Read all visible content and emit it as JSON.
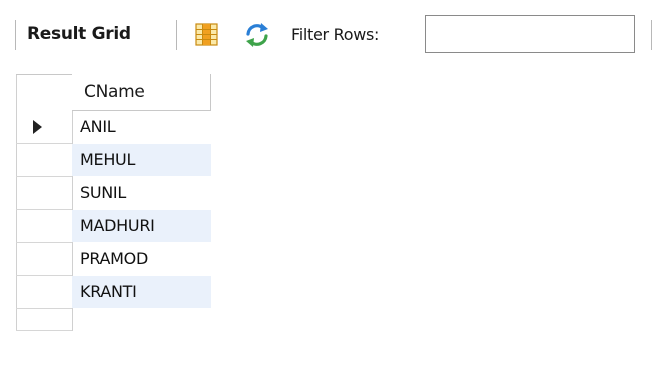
{
  "toolbar": {
    "result_grid_label": "Result Grid",
    "grid_icon": "grid-layout-icon",
    "refresh_icon": "refresh-icon",
    "filter_label": "Filter Rows:",
    "filter_value": "",
    "filter_placeholder": ""
  },
  "grid": {
    "columns": [
      "CName"
    ],
    "rows": [
      {
        "cname": "ANIL",
        "current": true
      },
      {
        "cname": "MEHUL",
        "current": false
      },
      {
        "cname": "SUNIL",
        "current": false
      },
      {
        "cname": "MADHURI",
        "current": false
      },
      {
        "cname": "PRAMOD",
        "current": false
      },
      {
        "cname": "KRANTI",
        "current": false
      }
    ]
  },
  "colors": {
    "alt_row": "#eaf1fb",
    "grid_line": "#d0d0d0",
    "icon_orange": "#f0a020",
    "icon_blue": "#2a7fd6"
  }
}
